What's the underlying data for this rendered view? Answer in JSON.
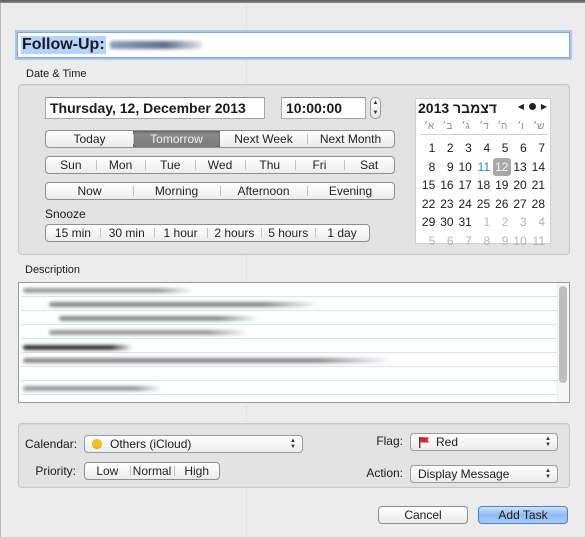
{
  "title_field": {
    "prefix": "Follow-Up:"
  },
  "date_time": {
    "section_label": "Date & Time",
    "date_value": "Thursday, 12, December 2013",
    "time_value": "10:00:00",
    "quick_days": [
      {
        "label": "Today",
        "active": false
      },
      {
        "label": "Tomorrow",
        "active": true
      },
      {
        "label": "Next Week",
        "active": false
      },
      {
        "label": "Next Month",
        "active": false
      }
    ],
    "weekdays": [
      "Sun",
      "Mon",
      "Tue",
      "Wed",
      "Thu",
      "Fri",
      "Sat"
    ],
    "times_of_day": [
      "Now",
      "Morning",
      "Afternoon",
      "Evening"
    ],
    "snooze_label": "Snooze",
    "snooze_options": [
      "15 min",
      "30 min",
      "1 hour",
      "2 hours",
      "5 hours",
      "1 day"
    ]
  },
  "calendar": {
    "month_title": "דצמבר 2013",
    "nav": {
      "prev": "◀",
      "today": "●",
      "next": "▶"
    },
    "weekday_headers": [
      "א׳",
      "ב׳",
      "ג׳",
      "ד׳",
      "ה׳",
      "ו׳",
      "ש׳"
    ],
    "today_day": 11,
    "selected_day": 12,
    "days": [
      [
        "1",
        "2",
        "3",
        "4",
        "5",
        "6",
        "7"
      ],
      [
        "8",
        "9",
        "10",
        "11",
        "12",
        "13",
        "14"
      ],
      [
        "15",
        "16",
        "17",
        "18",
        "19",
        "20",
        "21"
      ],
      [
        "22",
        "23",
        "24",
        "25",
        "26",
        "27",
        "28"
      ],
      [
        "29",
        "30",
        "31",
        "1",
        "2",
        "3",
        "4"
      ],
      [
        "5",
        "6",
        "7",
        "8",
        "9",
        "10",
        "11"
      ]
    ],
    "current_month_count": 31
  },
  "description": {
    "section_label": "Description"
  },
  "options": {
    "calendar_label": "Calendar:",
    "calendar_value": "Others (iCloud)",
    "calendar_color": "#f2c01b",
    "priority_label": "Priority:",
    "priority_options": [
      "Low",
      "Normal",
      "High"
    ],
    "flag_label": "Flag:",
    "flag_value": "Red",
    "flag_color": "#d8252e",
    "action_label": "Action:",
    "action_value": "Display Message"
  },
  "buttons": {
    "cancel": "Cancel",
    "add_task": "Add Task"
  }
}
